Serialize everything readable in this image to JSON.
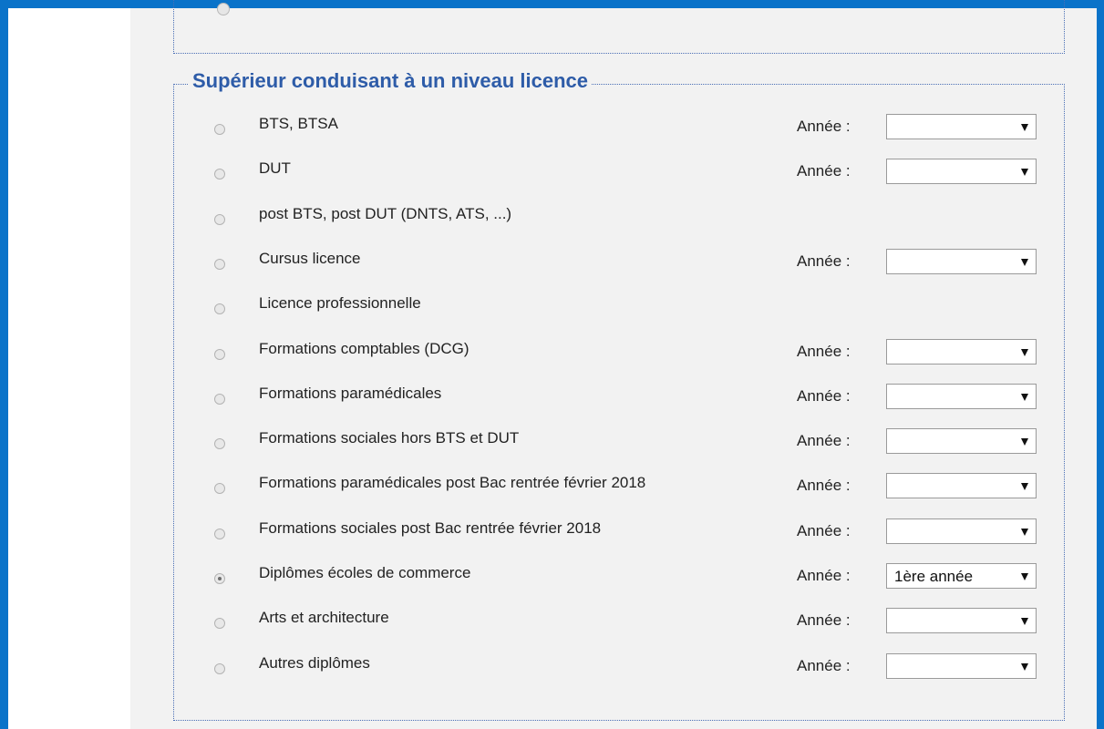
{
  "section": {
    "title": "Supérieur conduisant à un niveau licence",
    "year_label": "Année :",
    "items": [
      {
        "label": "BTS, BTSA",
        "has_year": true,
        "selected": false,
        "year_value": ""
      },
      {
        "label": "DUT",
        "has_year": true,
        "selected": false,
        "year_value": ""
      },
      {
        "label": "post BTS, post DUT (DNTS, ATS, ...)",
        "has_year": false,
        "selected": false,
        "year_value": ""
      },
      {
        "label": "Cursus licence",
        "has_year": true,
        "selected": false,
        "year_value": ""
      },
      {
        "label": "Licence professionnelle",
        "has_year": false,
        "selected": false,
        "year_value": ""
      },
      {
        "label": "Formations comptables (DCG)",
        "has_year": true,
        "selected": false,
        "year_value": ""
      },
      {
        "label": "Formations paramédicales",
        "has_year": true,
        "selected": false,
        "year_value": ""
      },
      {
        "label": "Formations sociales hors BTS et DUT",
        "has_year": true,
        "selected": false,
        "year_value": ""
      },
      {
        "label": "Formations paramédicales post Bac rentrée février 2018",
        "has_year": true,
        "selected": false,
        "year_value": ""
      },
      {
        "label": "Formations sociales post Bac rentrée février 2018",
        "has_year": true,
        "selected": false,
        "year_value": ""
      },
      {
        "label": "Diplômes écoles de commerce",
        "has_year": true,
        "selected": true,
        "year_value": "1ère année"
      },
      {
        "label": "Arts et architecture",
        "has_year": true,
        "selected": false,
        "year_value": ""
      },
      {
        "label": "Autres diplômes",
        "has_year": true,
        "selected": false,
        "year_value": ""
      }
    ]
  },
  "colors": {
    "frame": "#0a73c9",
    "legend": "#2e5ca8",
    "panel_background": "#f2f2f2",
    "fieldset_border": "#4a6fb5"
  }
}
